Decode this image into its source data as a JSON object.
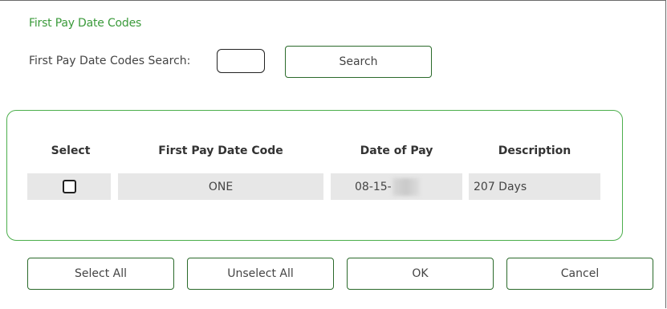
{
  "dialog": {
    "title": "First Pay Date Codes",
    "search_label": "First Pay Date Codes Search:",
    "search_value": "",
    "search_button": "Search"
  },
  "table": {
    "columns": [
      "Select",
      "First Pay Date Code",
      "Date of Pay",
      "Description"
    ],
    "rows": [
      {
        "selected": false,
        "code": "ONE",
        "date_of_pay": "08-15-",
        "description": "207 Days"
      }
    ]
  },
  "footer": {
    "select_all": "Select All",
    "unselect_all": "Unselect All",
    "ok": "OK",
    "cancel": "Cancel"
  },
  "colors": {
    "title": "#3a9a3a",
    "panel_border": "#4cae4c",
    "button_border": "#2a6a2a",
    "cell_background": "#e7e7e7"
  }
}
